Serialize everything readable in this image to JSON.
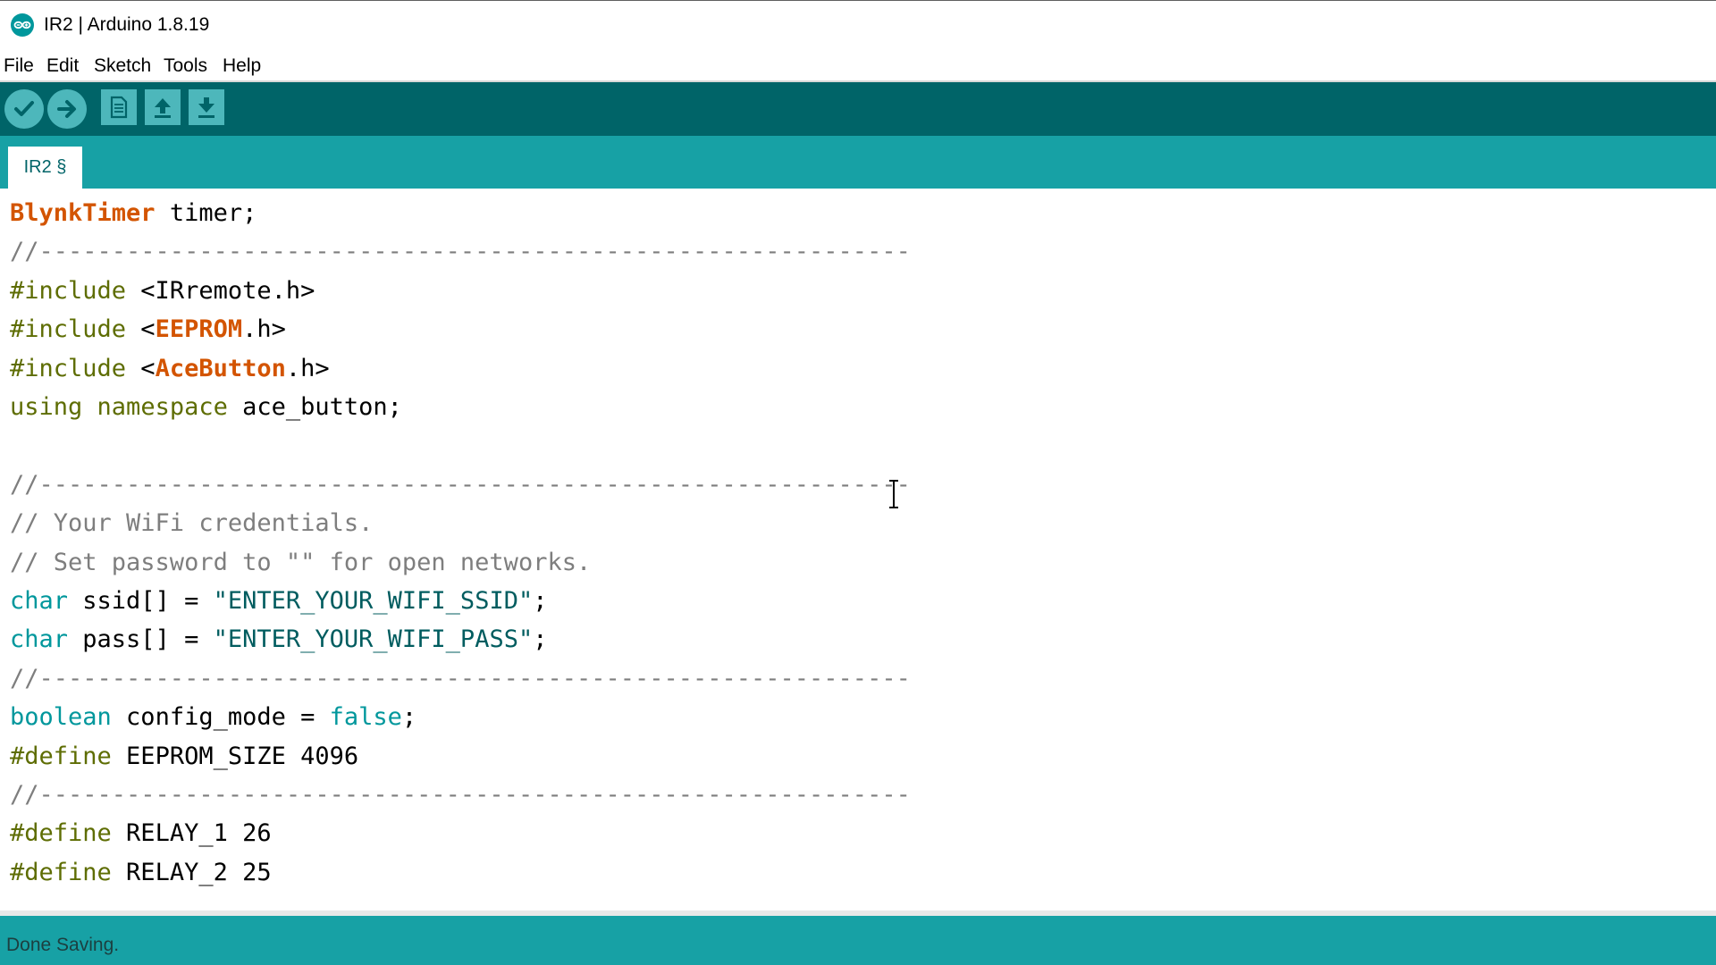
{
  "window": {
    "title": "IR2 | Arduino 1.8.19",
    "icon": "arduino-logo-icon"
  },
  "menu": [
    "File",
    "Edit",
    "Sketch",
    "Tools",
    "Help"
  ],
  "toolbar": {
    "buttons": [
      "verify-check-icon",
      "upload-arrow-icon",
      "new-sketch-icon",
      "open-sketch-icon",
      "save-sketch-icon"
    ]
  },
  "tabs": [
    {
      "label": "IR2 §"
    }
  ],
  "editor": {
    "lines": [
      [
        {
          "t": "BlynkTimer",
          "c": "kw-orange"
        },
        {
          "t": " timer;"
        }
      ],
      [
        {
          "t": "//------------------------------------------------------------",
          "c": "comment"
        }
      ],
      [
        {
          "t": "#include",
          "c": "kw-pre"
        },
        {
          "t": " <IRremote.h>"
        }
      ],
      [
        {
          "t": "#include",
          "c": "kw-pre"
        },
        {
          "t": " <"
        },
        {
          "t": "EEPROM",
          "c": "kw-orange"
        },
        {
          "t": ".h>"
        }
      ],
      [
        {
          "t": "#include",
          "c": "kw-pre"
        },
        {
          "t": " <"
        },
        {
          "t": "AceButton",
          "c": "kw-orange"
        },
        {
          "t": ".h>"
        }
      ],
      [
        {
          "t": "using",
          "c": "kw-pre"
        },
        {
          "t": " "
        },
        {
          "t": "namespace",
          "c": "kw-pre"
        },
        {
          "t": " ace_button;"
        }
      ],
      [
        {
          "t": ""
        }
      ],
      [
        {
          "t": "//------------------------------------------------------------",
          "c": "comment"
        }
      ],
      [
        {
          "t": "// Your WiFi credentials.",
          "c": "comment"
        }
      ],
      [
        {
          "t": "// Set password to \"\" for open networks.",
          "c": "comment"
        }
      ],
      [
        {
          "t": "char",
          "c": "kw-teal"
        },
        {
          "t": " ssid[] = "
        },
        {
          "t": "\"ENTER_YOUR_WIFI_SSID\"",
          "c": "str"
        },
        {
          "t": ";"
        }
      ],
      [
        {
          "t": "char",
          "c": "kw-teal"
        },
        {
          "t": " pass[] = "
        },
        {
          "t": "\"ENTER_YOUR_WIFI_PASS\"",
          "c": "str"
        },
        {
          "t": ";"
        }
      ],
      [
        {
          "t": "//------------------------------------------------------------",
          "c": "comment"
        }
      ],
      [
        {
          "t": "boolean",
          "c": "kw-teal"
        },
        {
          "t": " config_mode = "
        },
        {
          "t": "false",
          "c": "kw-teal"
        },
        {
          "t": ";"
        }
      ],
      [
        {
          "t": "#define",
          "c": "kw-pre"
        },
        {
          "t": " EEPROM_SIZE 4096"
        }
      ],
      [
        {
          "t": "//------------------------------------------------------------",
          "c": "comment"
        }
      ],
      [
        {
          "t": "#define",
          "c": "kw-pre"
        },
        {
          "t": " RELAY_1 26"
        }
      ],
      [
        {
          "t": "#define",
          "c": "kw-pre"
        },
        {
          "t": " RELAY_2 25"
        }
      ]
    ]
  },
  "status": {
    "message": "Done Saving."
  },
  "colors": {
    "toolbar": "#006468",
    "tabbar": "#17a1a5",
    "statusbar": "#17a1a5",
    "button": "#4db7bb",
    "keyword_type": "#d35400",
    "keyword_pre": "#5e6d03",
    "keyword_teal": "#00979c",
    "comment": "#7e7e7e"
  }
}
